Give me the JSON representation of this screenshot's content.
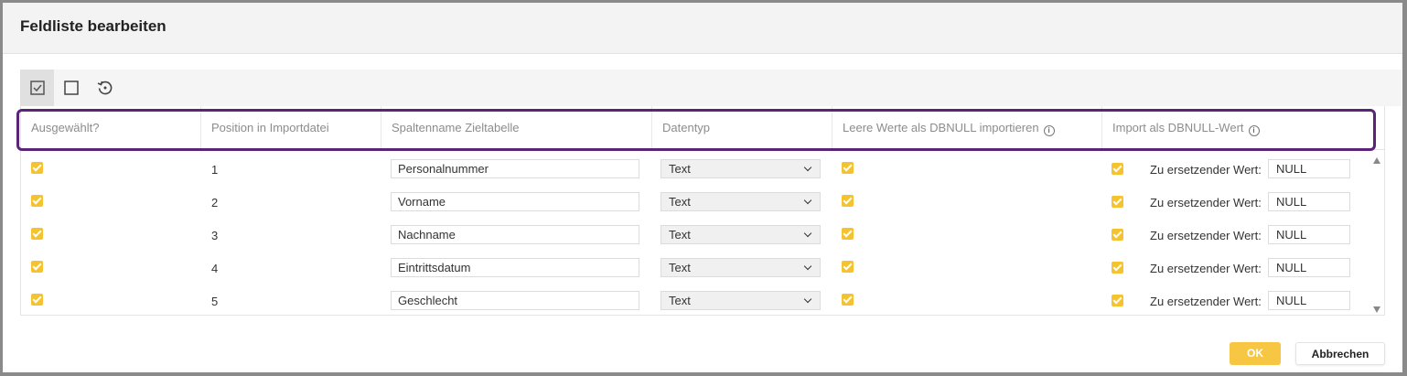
{
  "dialog": {
    "title": "Feldliste bearbeiten"
  },
  "toolbar": {
    "items": [
      {
        "icon": "checkbox-checked-icon",
        "active": true
      },
      {
        "icon": "checkbox-unchecked-icon",
        "active": false
      },
      {
        "icon": "reset-icon",
        "active": false
      }
    ]
  },
  "grid": {
    "columns": [
      "Ausgewählt?",
      "Position in Importdatei",
      "Spaltenname Zieltabelle",
      "Datentyp",
      "Leere Werte als DBNULL importieren",
      "Import als DBNULL-Wert"
    ],
    "replace_label": "Zu ersetzender Wert:",
    "rows": [
      {
        "selected": true,
        "position": "1",
        "name": "Personalnummer",
        "type": "Text",
        "empty_as_dbnull": true,
        "import_as_dbnull": true,
        "replace_value": "NULL"
      },
      {
        "selected": true,
        "position": "2",
        "name": "Vorname",
        "type": "Text",
        "empty_as_dbnull": true,
        "import_as_dbnull": true,
        "replace_value": "NULL"
      },
      {
        "selected": true,
        "position": "3",
        "name": "Nachname",
        "type": "Text",
        "empty_as_dbnull": true,
        "import_as_dbnull": true,
        "replace_value": "NULL"
      },
      {
        "selected": true,
        "position": "4",
        "name": "Eintrittsdatum",
        "type": "Text",
        "empty_as_dbnull": true,
        "import_as_dbnull": true,
        "replace_value": "NULL"
      },
      {
        "selected": true,
        "position": "5",
        "name": "Geschlecht",
        "type": "Text",
        "empty_as_dbnull": true,
        "import_as_dbnull": true,
        "replace_value": "NULL"
      }
    ]
  },
  "footer": {
    "ok_label": "OK",
    "cancel_label": "Abbrechen"
  },
  "colors": {
    "accent": "#F5C330",
    "highlight": "#5B2477"
  }
}
